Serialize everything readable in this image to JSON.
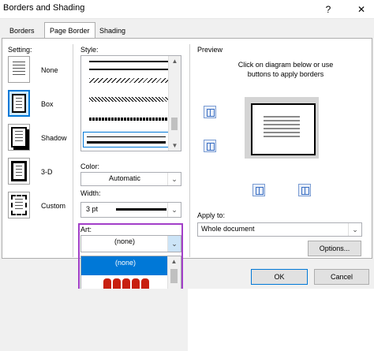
{
  "window": {
    "title": "Borders and Shading",
    "help": "?",
    "close": "✕"
  },
  "tabs": [
    {
      "label": "Borders"
    },
    {
      "label": "Page Border"
    },
    {
      "label": "Shading"
    }
  ],
  "setting": {
    "label": "Setting:",
    "items": [
      {
        "label": "None"
      },
      {
        "label": "Box"
      },
      {
        "label": "Shadow"
      },
      {
        "label": "3-D"
      },
      {
        "label": "Custom"
      }
    ]
  },
  "style": {
    "label": "Style:"
  },
  "color": {
    "label": "Color:",
    "value": "Automatic"
  },
  "width": {
    "label": "Width:",
    "value": "3 pt"
  },
  "art": {
    "label": "Art:",
    "value": "(none)",
    "selected_option": "(none)"
  },
  "preview": {
    "label": "Preview",
    "instruction": "Click on diagram below or use buttons to apply borders"
  },
  "apply_to": {
    "label": "Apply to:",
    "value": "Whole document"
  },
  "buttons": {
    "options": "Options...",
    "ok": "OK",
    "cancel": "Cancel"
  },
  "colors": {
    "accent": "#0078d7",
    "highlight": "#a23fc8"
  }
}
